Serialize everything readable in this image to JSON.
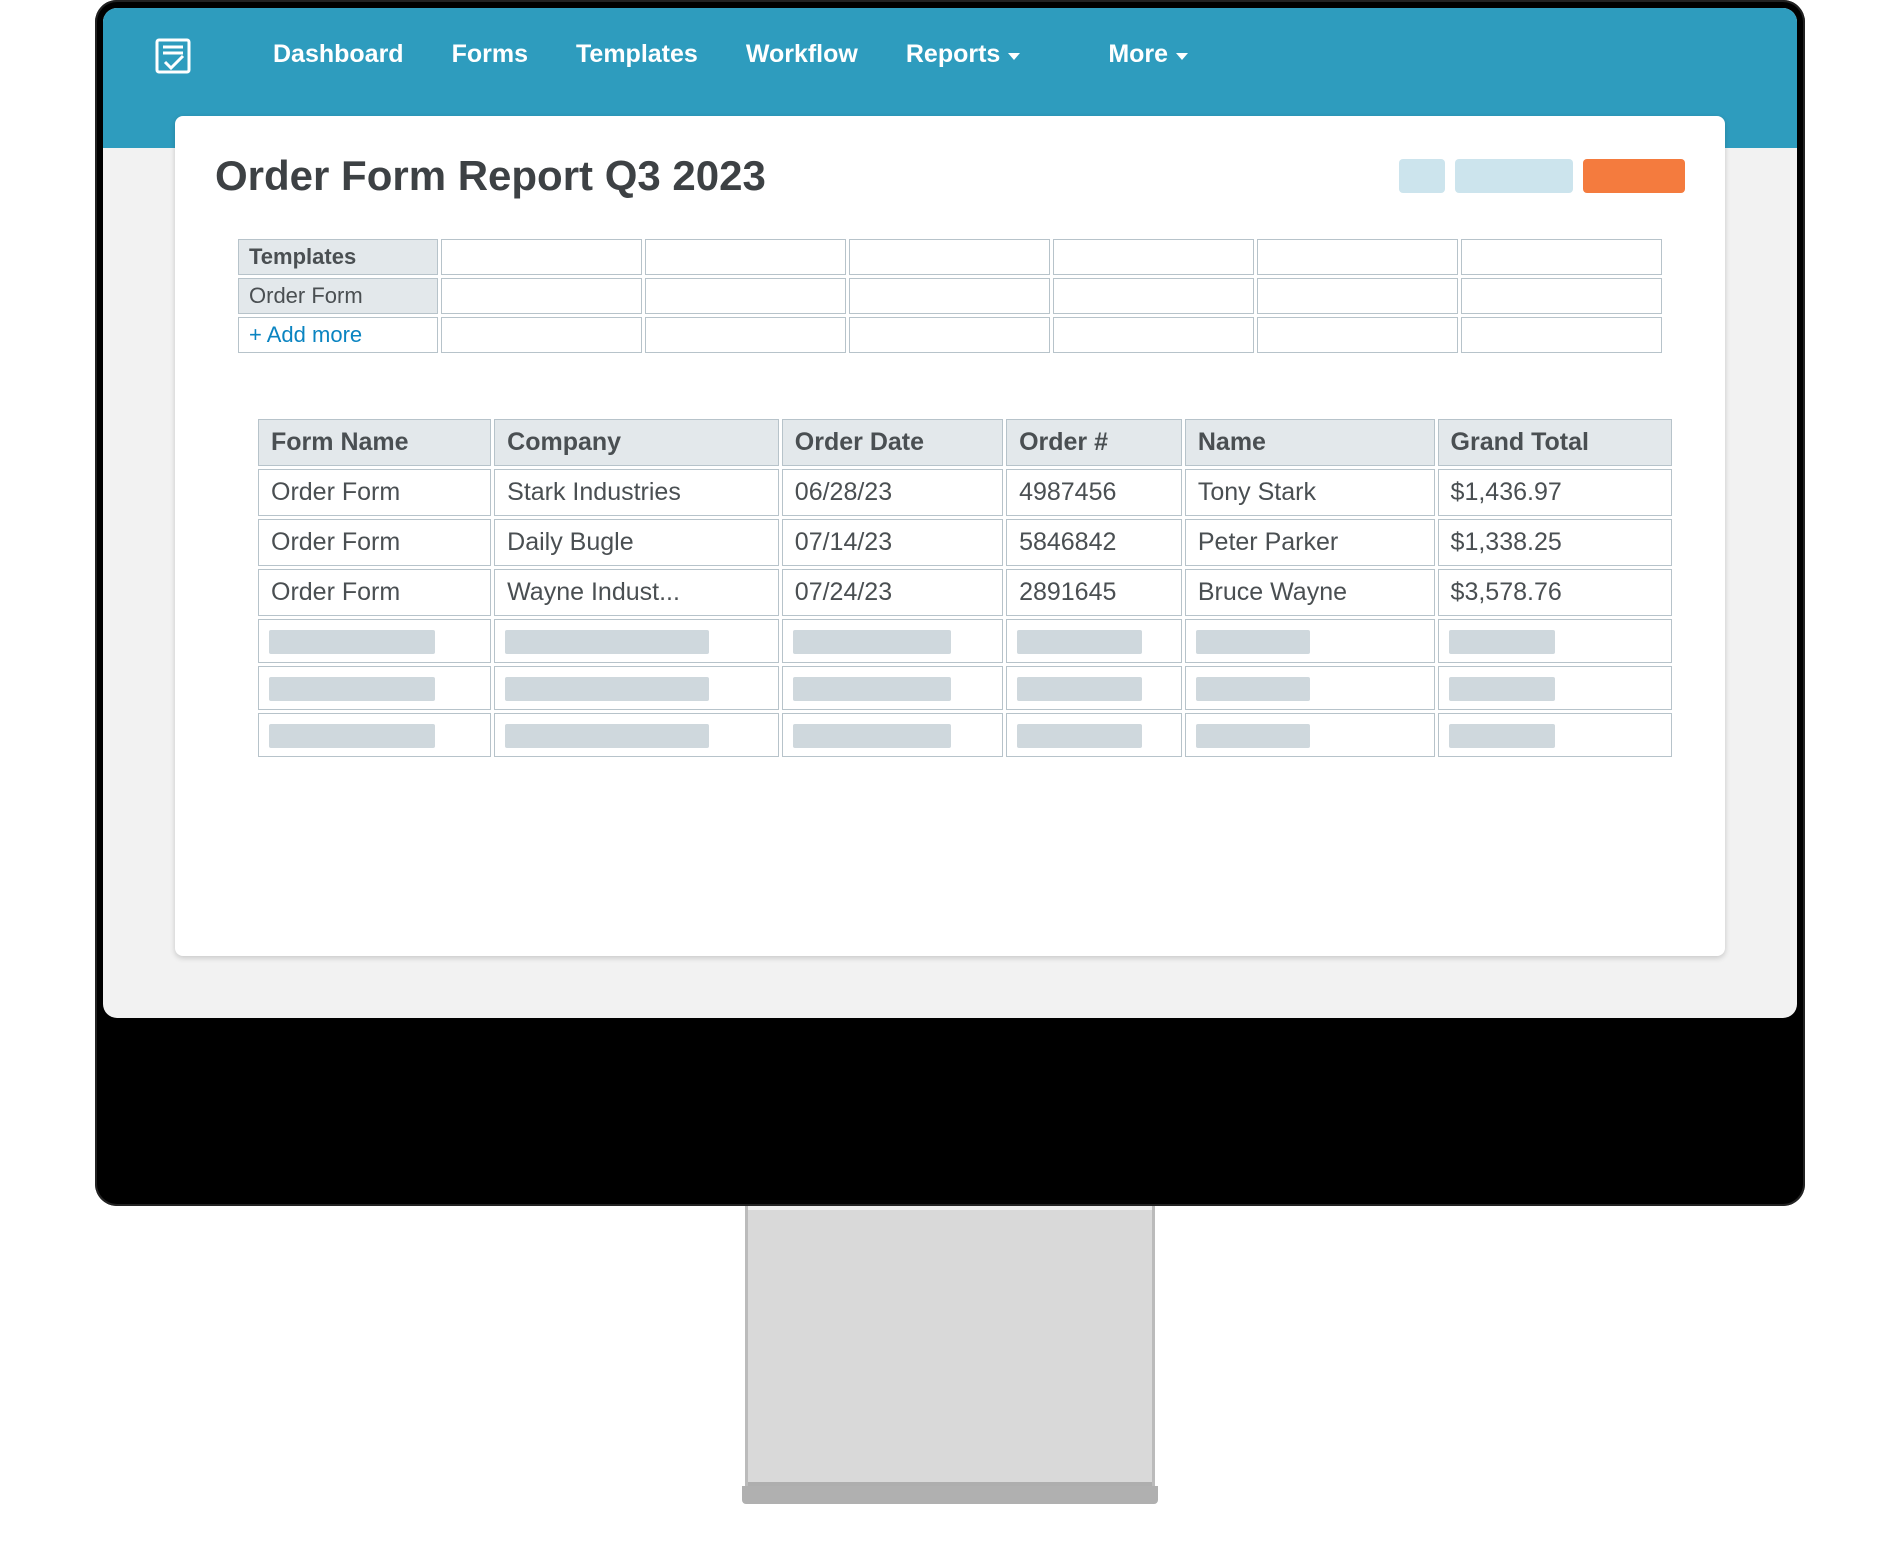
{
  "nav": {
    "items": [
      {
        "label": "Dashboard"
      },
      {
        "label": "Forms"
      },
      {
        "label": "Templates"
      },
      {
        "label": "Workflow"
      },
      {
        "label": "Reports",
        "dropdown": true
      },
      {
        "label": "More",
        "dropdown": true
      }
    ]
  },
  "page": {
    "title": "Order Form Report Q3 2023"
  },
  "templates_panel": {
    "header": "Templates",
    "row1": "Order Form",
    "add_more": "+ Add more",
    "empty_cols": 6
  },
  "table": {
    "columns": [
      "Form Name",
      "Company",
      "Order Date",
      "Order #",
      "Name",
      "Grand Total"
    ],
    "rows": [
      {
        "form": "Order Form",
        "company": "Stark Industries",
        "date": "06/28/23",
        "order": "4987456",
        "name": "Tony Stark",
        "total": "$1,436.97"
      },
      {
        "form": "Order Form",
        "company": "Daily Bugle",
        "date": "07/14/23",
        "order": "5846842",
        "name": "Peter Parker",
        "total": "$1,338.25"
      },
      {
        "form": "Order Form",
        "company": "Wayne Indust...",
        "date": "07/24/23",
        "order": "2891645",
        "name": "Bruce Wayne",
        "total": "$3,578.76"
      }
    ],
    "placeholder_rows": 3
  }
}
